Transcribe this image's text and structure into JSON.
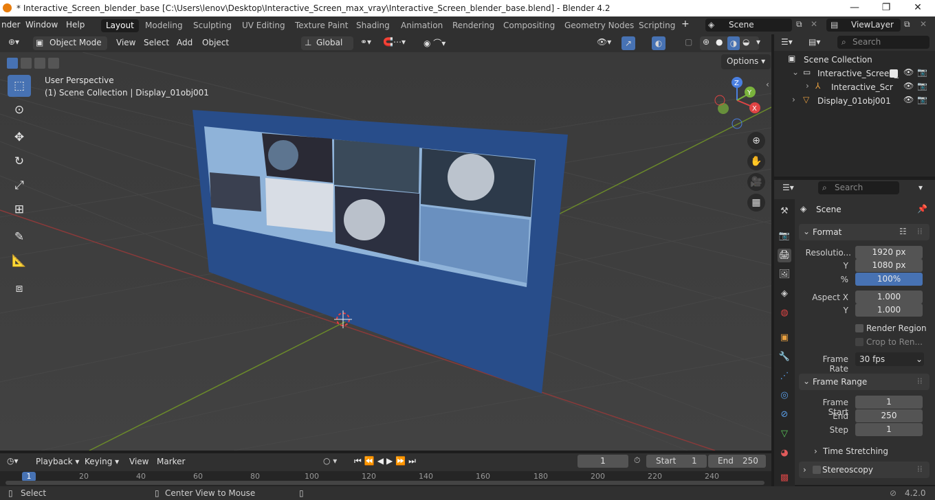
{
  "window": {
    "title": "* Interactive_Screen_blender_base [C:\\Users\\lenov\\Desktop\\Interactive_Screen_max_vray\\Interactive_Screen_blender_base.blend] - Blender 4.2",
    "minimize": "—",
    "maximize": "❐",
    "close": "✕"
  },
  "menu": {
    "render": "nder",
    "window": "Window",
    "help": "Help"
  },
  "workspaces": [
    "Layout",
    "Modeling",
    "Sculpting",
    "UV Editing",
    "Texture Paint",
    "Shading",
    "Animation",
    "Rendering",
    "Compositing",
    "Geometry Nodes",
    "Scripting"
  ],
  "scene": {
    "name": "Scene",
    "view_layer": "ViewLayer"
  },
  "viewport_header": {
    "mode": "Object Mode",
    "view": "View",
    "select": "Select",
    "add": "Add",
    "object": "Object",
    "transform": "Global",
    "options": "Options"
  },
  "viewport": {
    "perspective": "User Perspective",
    "collection_info": "(1) Scene Collection | Display_01obj001",
    "screen_color": "#284d8a"
  },
  "outliner": {
    "search_placeholder": "Search",
    "root": "Scene Collection",
    "items": [
      {
        "label": "Interactive_Screen_"
      },
      {
        "label": "Interactive_Scr"
      },
      {
        "label": "Display_01obj001"
      }
    ]
  },
  "properties": {
    "search_placeholder": "Search",
    "scene_title": "Scene",
    "format": {
      "title": "Format",
      "resolution_x_label": "Resolutio...",
      "resolution_x": "1920 px",
      "y_label": "Y",
      "resolution_y": "1080 px",
      "percent_label": "%",
      "percent": "100%",
      "aspect_x_label": "Aspect X",
      "aspect_x": "1.000",
      "aspect_y_label": "Y",
      "aspect_y": "1.000",
      "render_region": "Render Region",
      "crop": "Crop to Ren...",
      "frame_rate_label": "Frame Rate",
      "frame_rate": "30 fps"
    },
    "frame_range": {
      "title": "Frame Range",
      "start_label": "Frame Start",
      "start": "1",
      "end_label": "End",
      "end": "250",
      "step_label": "Step",
      "step": "1"
    },
    "time_stretching": "Time Stretching",
    "stereoscopy": "Stereoscopy"
  },
  "timeline": {
    "playback": "Playback",
    "keying": "Keying",
    "view": "View",
    "marker": "Marker",
    "current_frame": "1",
    "start_label": "Start",
    "start": "1",
    "end_label": "End",
    "end": "250",
    "ruler": [
      "1",
      "20",
      "40",
      "60",
      "80",
      "100",
      "120",
      "140",
      "160",
      "180",
      "200",
      "220",
      "240"
    ]
  },
  "statusbar": {
    "select": "Select",
    "center_view": "Center View to Mouse",
    "version": "4.2.0"
  }
}
